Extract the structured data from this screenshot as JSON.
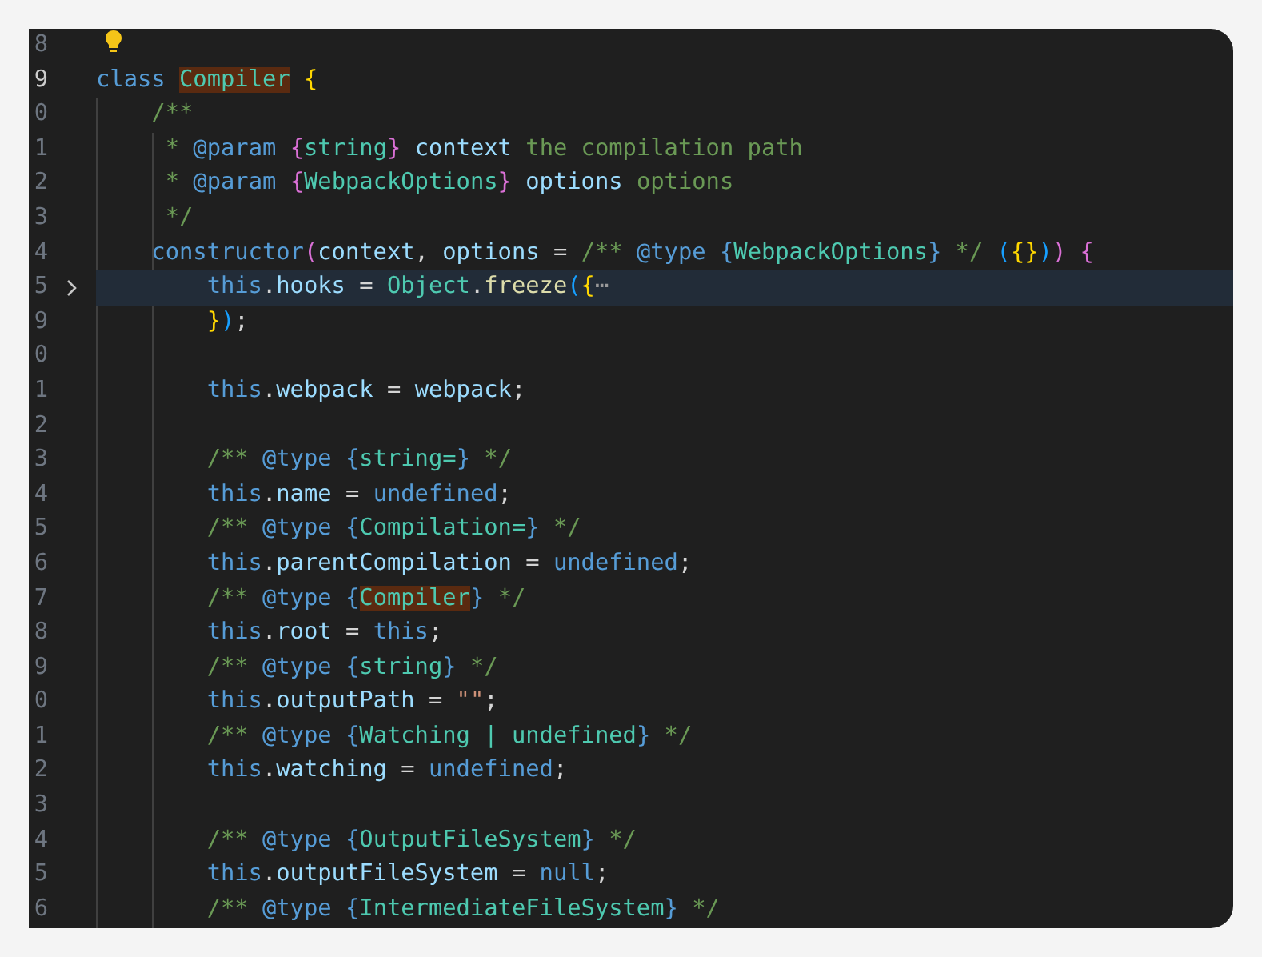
{
  "lines": [
    {
      "number": "8",
      "cursor": false,
      "highlighted": false,
      "folded": false
    },
    {
      "number": "9",
      "cursor": true,
      "highlighted": false,
      "folded": false,
      "tokens": [
        {
          "text": "class ",
          "kind": "keyword"
        },
        {
          "text": "Compiler",
          "kind": "class-match"
        },
        {
          "text": " {",
          "kind": "bracket1"
        }
      ]
    },
    {
      "number": "0",
      "cursor": false,
      "highlighted": false,
      "folded": false,
      "tokens": [
        {
          "text": "    /**",
          "kind": "comment"
        }
      ]
    },
    {
      "number": "1",
      "cursor": false,
      "highlighted": false,
      "folded": false,
      "tokens": [
        {
          "text": "     * ",
          "kind": "comment"
        },
        {
          "text": "@param ",
          "kind": "tag"
        },
        {
          "text": "{",
          "kind": "doc-brace"
        },
        {
          "text": "string",
          "kind": "type"
        },
        {
          "text": "} ",
          "kind": "doc-brace"
        },
        {
          "text": "context",
          "kind": "var"
        },
        {
          "text": " the compilation path",
          "kind": "comment"
        }
      ]
    },
    {
      "number": "2",
      "cursor": false,
      "highlighted": false,
      "folded": false,
      "tokens": [
        {
          "text": "     * ",
          "kind": "comment"
        },
        {
          "text": "@param ",
          "kind": "tag"
        },
        {
          "text": "{",
          "kind": "doc-brace"
        },
        {
          "text": "WebpackOptions",
          "kind": "type"
        },
        {
          "text": "} ",
          "kind": "doc-brace"
        },
        {
          "text": "options",
          "kind": "var"
        },
        {
          "text": " options",
          "kind": "comment"
        }
      ]
    },
    {
      "number": "3",
      "cursor": false,
      "highlighted": false,
      "folded": false,
      "tokens": [
        {
          "text": "     */",
          "kind": "comment"
        }
      ]
    },
    {
      "number": "4",
      "cursor": false,
      "highlighted": false,
      "folded": false,
      "tokens": [
        {
          "text": "    constructor",
          "kind": "keyword"
        },
        {
          "text": "(",
          "kind": "bracket2"
        },
        {
          "text": "context",
          "kind": "var"
        },
        {
          "text": ", ",
          "kind": "plain"
        },
        {
          "text": "options",
          "kind": "var"
        },
        {
          "text": " = ",
          "kind": "plain"
        },
        {
          "text": "/** ",
          "kind": "comment"
        },
        {
          "text": "@type ",
          "kind": "tag"
        },
        {
          "text": "{",
          "kind": "type-brace"
        },
        {
          "text": "WebpackOptions",
          "kind": "type"
        },
        {
          "text": "}",
          "kind": "type-brace"
        },
        {
          "text": " */ ",
          "kind": "comment"
        },
        {
          "text": "(",
          "kind": "bracket3"
        },
        {
          "text": "{}",
          "kind": "bracket1"
        },
        {
          "text": ")",
          "kind": "bracket3"
        },
        {
          "text": ") {",
          "kind": "bracket2"
        }
      ]
    },
    {
      "number": "5",
      "cursor": false,
      "highlighted": true,
      "folded": true,
      "tokens": [
        {
          "text": "        this",
          "kind": "keyword"
        },
        {
          "text": ".",
          "kind": "plain"
        },
        {
          "text": "hooks",
          "kind": "prop"
        },
        {
          "text": " = ",
          "kind": "plain"
        },
        {
          "text": "Object",
          "kind": "type"
        },
        {
          "text": ".",
          "kind": "plain"
        },
        {
          "text": "freeze",
          "kind": "func"
        },
        {
          "text": "(",
          "kind": "bracket3"
        },
        {
          "text": "{",
          "kind": "bracket1"
        },
        {
          "text": "⋯",
          "kind": "ellipsis"
        }
      ]
    },
    {
      "number": "9",
      "cursor": false,
      "highlighted": false,
      "folded": false,
      "tokens": [
        {
          "text": "        }",
          "kind": "bracket1"
        },
        {
          "text": ")",
          "kind": "bracket3"
        },
        {
          "text": ";",
          "kind": "plain"
        }
      ]
    },
    {
      "number": "0",
      "cursor": false,
      "highlighted": false,
      "folded": false
    },
    {
      "number": "1",
      "cursor": false,
      "highlighted": false,
      "folded": false,
      "tokens": [
        {
          "text": "        this",
          "kind": "keyword"
        },
        {
          "text": ".",
          "kind": "plain"
        },
        {
          "text": "webpack",
          "kind": "prop"
        },
        {
          "text": " = ",
          "kind": "plain"
        },
        {
          "text": "webpack",
          "kind": "var"
        },
        {
          "text": ";",
          "kind": "plain"
        }
      ]
    },
    {
      "number": "2",
      "cursor": false,
      "highlighted": false,
      "folded": false
    },
    {
      "number": "3",
      "cursor": false,
      "highlighted": false,
      "folded": false,
      "tokens": [
        {
          "text": "        /** ",
          "kind": "comment"
        },
        {
          "text": "@type ",
          "kind": "tag"
        },
        {
          "text": "{",
          "kind": "type-brace"
        },
        {
          "text": "string=",
          "kind": "type"
        },
        {
          "text": "}",
          "kind": "type-brace"
        },
        {
          "text": " */",
          "kind": "comment"
        }
      ]
    },
    {
      "number": "4",
      "cursor": false,
      "highlighted": false,
      "folded": false,
      "tokens": [
        {
          "text": "        this",
          "kind": "keyword"
        },
        {
          "text": ".",
          "kind": "plain"
        },
        {
          "text": "name",
          "kind": "prop"
        },
        {
          "text": " = ",
          "kind": "plain"
        },
        {
          "text": "undefined",
          "kind": "keyword"
        },
        {
          "text": ";",
          "kind": "plain"
        }
      ]
    },
    {
      "number": "5",
      "cursor": false,
      "highlighted": false,
      "folded": false,
      "tokens": [
        {
          "text": "        /** ",
          "kind": "comment"
        },
        {
          "text": "@type ",
          "kind": "tag"
        },
        {
          "text": "{",
          "kind": "type-brace"
        },
        {
          "text": "Compilation=",
          "kind": "type"
        },
        {
          "text": "}",
          "kind": "type-brace"
        },
        {
          "text": " */",
          "kind": "comment"
        }
      ]
    },
    {
      "number": "6",
      "cursor": false,
      "highlighted": false,
      "folded": false,
      "tokens": [
        {
          "text": "        this",
          "kind": "keyword"
        },
        {
          "text": ".",
          "kind": "plain"
        },
        {
          "text": "parentCompilation",
          "kind": "prop"
        },
        {
          "text": " = ",
          "kind": "plain"
        },
        {
          "text": "undefined",
          "kind": "keyword"
        },
        {
          "text": ";",
          "kind": "plain"
        }
      ]
    },
    {
      "number": "7",
      "cursor": false,
      "highlighted": false,
      "folded": false,
      "tokens": [
        {
          "text": "        /** ",
          "kind": "comment"
        },
        {
          "text": "@type ",
          "kind": "tag"
        },
        {
          "text": "{",
          "kind": "type-brace"
        },
        {
          "text": "Compiler",
          "kind": "class-match"
        },
        {
          "text": "}",
          "kind": "type-brace"
        },
        {
          "text": " */",
          "kind": "comment"
        }
      ]
    },
    {
      "number": "8",
      "cursor": false,
      "highlighted": false,
      "folded": false,
      "tokens": [
        {
          "text": "        this",
          "kind": "keyword"
        },
        {
          "text": ".",
          "kind": "plain"
        },
        {
          "text": "root",
          "kind": "prop"
        },
        {
          "text": " = ",
          "kind": "plain"
        },
        {
          "text": "this",
          "kind": "keyword"
        },
        {
          "text": ";",
          "kind": "plain"
        }
      ]
    },
    {
      "number": "9",
      "cursor": false,
      "highlighted": false,
      "folded": false,
      "tokens": [
        {
          "text": "        /** ",
          "kind": "comment"
        },
        {
          "text": "@type ",
          "kind": "tag"
        },
        {
          "text": "{",
          "kind": "type-brace"
        },
        {
          "text": "string",
          "kind": "type"
        },
        {
          "text": "}",
          "kind": "type-brace"
        },
        {
          "text": " */",
          "kind": "comment"
        }
      ]
    },
    {
      "number": "0",
      "cursor": false,
      "highlighted": false,
      "folded": false,
      "tokens": [
        {
          "text": "        this",
          "kind": "keyword"
        },
        {
          "text": ".",
          "kind": "plain"
        },
        {
          "text": "outputPath",
          "kind": "prop"
        },
        {
          "text": " = ",
          "kind": "plain"
        },
        {
          "text": "\"\"",
          "kind": "string"
        },
        {
          "text": ";",
          "kind": "plain"
        }
      ]
    },
    {
      "number": "1",
      "cursor": false,
      "highlighted": false,
      "folded": false,
      "tokens": [
        {
          "text": "        /** ",
          "kind": "comment"
        },
        {
          "text": "@type ",
          "kind": "tag"
        },
        {
          "text": "{",
          "kind": "type-brace"
        },
        {
          "text": "Watching | undefined",
          "kind": "type"
        },
        {
          "text": "}",
          "kind": "type-brace"
        },
        {
          "text": " */",
          "kind": "comment"
        }
      ]
    },
    {
      "number": "2",
      "cursor": false,
      "highlighted": false,
      "folded": false,
      "tokens": [
        {
          "text": "        this",
          "kind": "keyword"
        },
        {
          "text": ".",
          "kind": "plain"
        },
        {
          "text": "watching",
          "kind": "prop"
        },
        {
          "text": " = ",
          "kind": "plain"
        },
        {
          "text": "undefined",
          "kind": "keyword"
        },
        {
          "text": ";",
          "kind": "plain"
        }
      ]
    },
    {
      "number": "3",
      "cursor": false,
      "highlighted": false,
      "folded": false
    },
    {
      "number": "4",
      "cursor": false,
      "highlighted": false,
      "folded": false,
      "tokens": [
        {
          "text": "        /** ",
          "kind": "comment"
        },
        {
          "text": "@type ",
          "kind": "tag"
        },
        {
          "text": "{",
          "kind": "type-brace"
        },
        {
          "text": "OutputFileSystem",
          "kind": "type"
        },
        {
          "text": "}",
          "kind": "type-brace"
        },
        {
          "text": " */",
          "kind": "comment"
        }
      ]
    },
    {
      "number": "5",
      "cursor": false,
      "highlighted": false,
      "folded": false,
      "tokens": [
        {
          "text": "        this",
          "kind": "keyword"
        },
        {
          "text": ".",
          "kind": "plain"
        },
        {
          "text": "outputFileSystem",
          "kind": "prop"
        },
        {
          "text": " = ",
          "kind": "plain"
        },
        {
          "text": "null",
          "kind": "keyword"
        },
        {
          "text": ";",
          "kind": "plain"
        }
      ]
    },
    {
      "number": "6",
      "cursor": false,
      "highlighted": false,
      "folded": false,
      "tokens": [
        {
          "text": "        /** ",
          "kind": "comment"
        },
        {
          "text": "@type ",
          "kind": "tag"
        },
        {
          "text": "{",
          "kind": "type-brace"
        },
        {
          "text": "IntermediateFileSystem",
          "kind": "type"
        },
        {
          "text": "}",
          "kind": "type-brace"
        },
        {
          "text": " */",
          "kind": "comment"
        }
      ]
    }
  ]
}
